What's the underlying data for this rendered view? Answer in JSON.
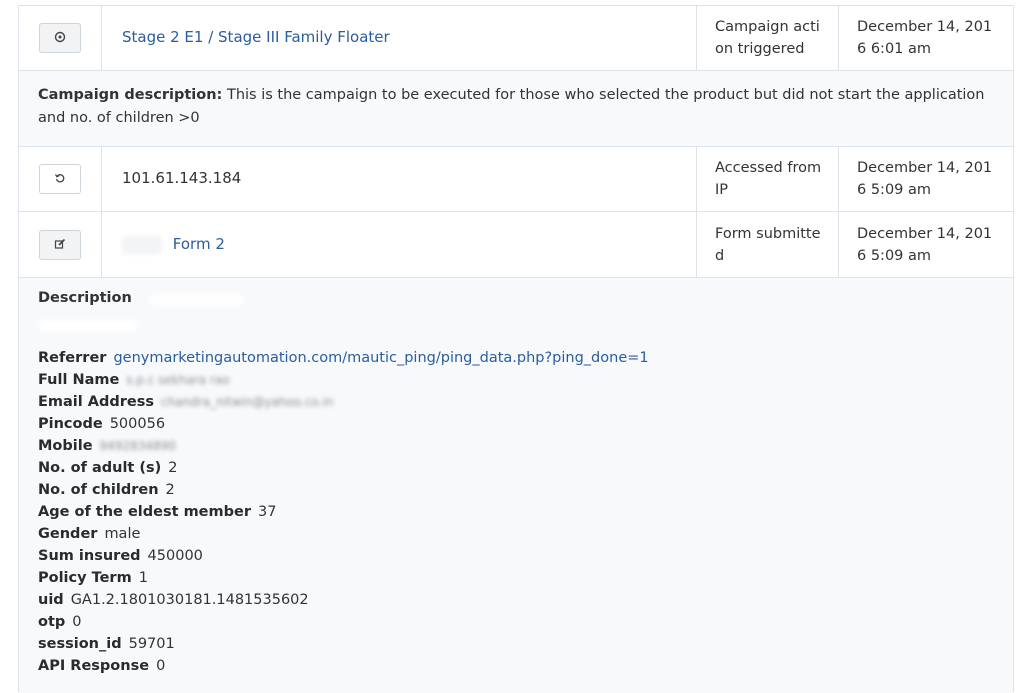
{
  "rows": [
    {
      "icon": "target-icon",
      "title": "Stage 2 E1 / Stage III Family Floater",
      "type": "Campaign action triggered",
      "date": "December 14, 2016 6:01 am"
    },
    {
      "icon": "refresh-icon",
      "title": "101.61.143.184",
      "type": "Accessed from IP",
      "date": "December 14, 2016 5:09 am"
    },
    {
      "icon": "edit-icon",
      "title": "Form 2",
      "type": "Form submitted",
      "date": "December 14, 2016 5:09 am"
    }
  ],
  "campaign_description": {
    "label": "Campaign description:",
    "text": "This is the campaign to be executed for those who selected the product but did not start the application and no. of children >0"
  },
  "detail": {
    "title": "Description",
    "fields": [
      {
        "key": "Referrer",
        "value": "genymarketingautomation.com/mautic_ping/ping_data.php?ping_done=1"
      },
      {
        "key": "Full Name",
        "value": "s.p.c sekhara rao"
      },
      {
        "key": "Email Address",
        "value": "chandra_nitwin@yahoo.co.in"
      },
      {
        "key": "Pincode",
        "value": "500056"
      },
      {
        "key": "Mobile",
        "value": "9492834890"
      },
      {
        "key": "No. of adult (s)",
        "value": "2"
      },
      {
        "key": "No. of children",
        "value": "2"
      },
      {
        "key": "Age of the eldest member",
        "value": "37"
      },
      {
        "key": "Gender",
        "value": "male"
      },
      {
        "key": "Sum insured",
        "value": "450000"
      },
      {
        "key": "Policy Term",
        "value": "1"
      },
      {
        "key": "uid",
        "value": "GA1.2.1801030181.1481535602"
      },
      {
        "key": "otp",
        "value": "0"
      },
      {
        "key": "session_id",
        "value": "59701"
      },
      {
        "key": "API Response",
        "value": "0"
      }
    ]
  },
  "colors": {
    "link": "#2a5d9f",
    "border": "#dde3ea",
    "panel": "#f7f9fb"
  }
}
